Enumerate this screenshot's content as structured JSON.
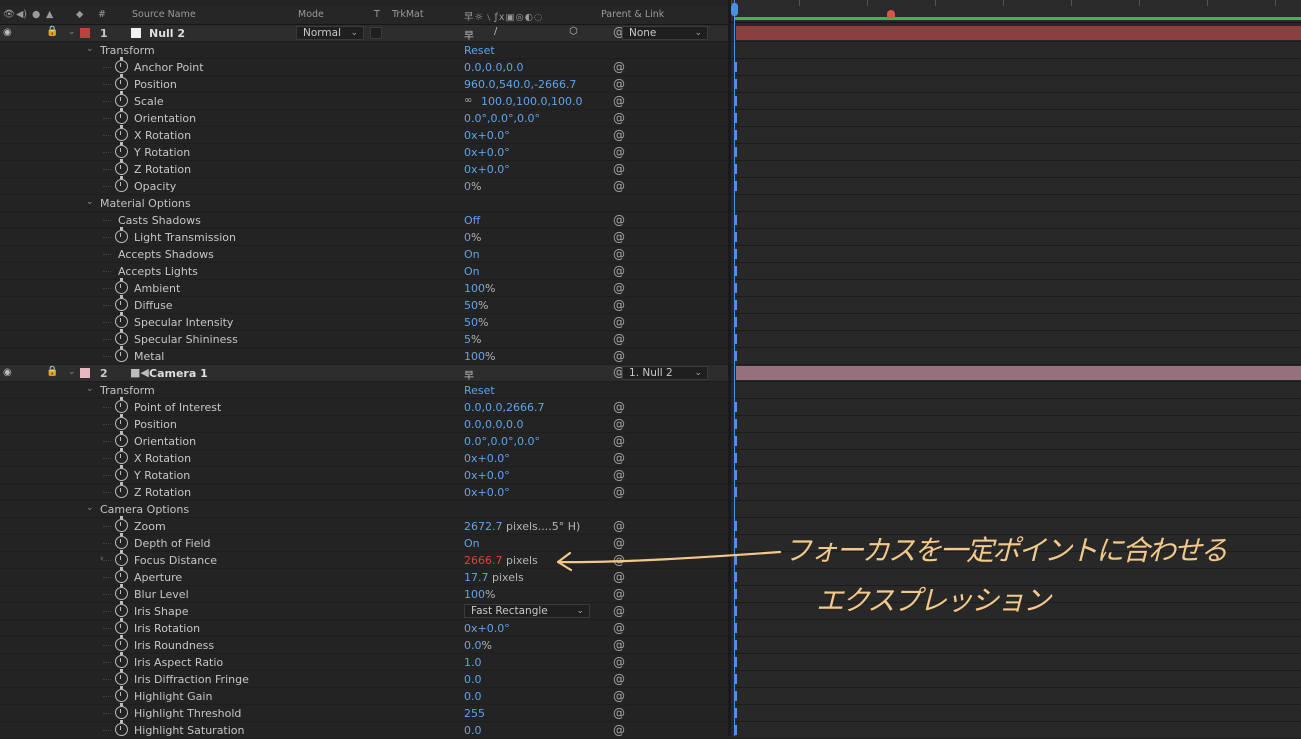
{
  "header": {
    "num": "#",
    "source_name": "Source Name",
    "mode": "Mode",
    "t": "T",
    "trkmat": "TrkMat",
    "parent_link": "Parent & Link"
  },
  "layers": [
    {
      "number": "1",
      "name": "Null 2",
      "label_color": "#c04040",
      "mode": "Normal",
      "parent": "None",
      "groups": [
        {
          "name": "Transform",
          "reset": "Reset",
          "props": [
            {
              "name": "Anchor Point",
              "stopwatch": true,
              "value": "0.0,0.0,0.0",
              "unit": ""
            },
            {
              "name": "Position",
              "stopwatch": true,
              "value": "960.0,540.0,-2666.7",
              "unit": ""
            },
            {
              "name": "Scale",
              "stopwatch": true,
              "value": "100.0,100.0,100.0",
              "unit": "",
              "link": true
            },
            {
              "name": "Orientation",
              "stopwatch": true,
              "value": "0.0°,0.0°,0.0°",
              "unit": ""
            },
            {
              "name": "X Rotation",
              "stopwatch": true,
              "value": "0x+0.0°",
              "unit": ""
            },
            {
              "name": "Y Rotation",
              "stopwatch": true,
              "value": "0x+0.0°",
              "unit": ""
            },
            {
              "name": "Z Rotation",
              "stopwatch": true,
              "value": "0x+0.0°",
              "unit": ""
            },
            {
              "name": "Opacity",
              "stopwatch": true,
              "value": "0",
              "unit": "%"
            }
          ]
        },
        {
          "name": "Material Options",
          "reset": "",
          "props": [
            {
              "name": "Casts Shadows",
              "stopwatch": false,
              "value": "Off",
              "unit": ""
            },
            {
              "name": "Light Transmission",
              "stopwatch": true,
              "value": "0",
              "unit": "%"
            },
            {
              "name": "Accepts Shadows",
              "stopwatch": false,
              "value": "On",
              "unit": ""
            },
            {
              "name": "Accepts Lights",
              "stopwatch": false,
              "value": "On",
              "unit": ""
            },
            {
              "name": "Ambient",
              "stopwatch": true,
              "value": "100",
              "unit": "%"
            },
            {
              "name": "Diffuse",
              "stopwatch": true,
              "value": "50",
              "unit": "%"
            },
            {
              "name": "Specular Intensity",
              "stopwatch": true,
              "value": "50",
              "unit": "%"
            },
            {
              "name": "Specular Shininess",
              "stopwatch": true,
              "value": "5",
              "unit": "%"
            },
            {
              "name": "Metal",
              "stopwatch": true,
              "value": "100",
              "unit": "%"
            }
          ]
        }
      ]
    },
    {
      "number": "2",
      "name": "Camera 1",
      "label_color": "#e6b8c4",
      "mode": "",
      "parent": "1. Null 2",
      "groups": [
        {
          "name": "Transform",
          "reset": "Reset",
          "props": [
            {
              "name": "Point of Interest",
              "stopwatch": true,
              "value": "0.0,0.0,2666.7",
              "unit": ""
            },
            {
              "name": "Position",
              "stopwatch": true,
              "value": "0.0,0.0,0.0",
              "unit": ""
            },
            {
              "name": "Orientation",
              "stopwatch": true,
              "value": "0.0°,0.0°,0.0°",
              "unit": ""
            },
            {
              "name": "X Rotation",
              "stopwatch": true,
              "value": "0x+0.0°",
              "unit": ""
            },
            {
              "name": "Y Rotation",
              "stopwatch": true,
              "value": "0x+0.0°",
              "unit": ""
            },
            {
              "name": "Z Rotation",
              "stopwatch": true,
              "value": "0x+0.0°",
              "unit": ""
            }
          ]
        },
        {
          "name": "Camera Options",
          "reset": "",
          "props": [
            {
              "name": "Zoom",
              "stopwatch": true,
              "value": "2672.7",
              "unit": " pixels....5° H)"
            },
            {
              "name": "Depth of Field",
              "stopwatch": true,
              "value": "On",
              "unit": ""
            },
            {
              "name": "Focus Distance",
              "stopwatch": true,
              "value": "2666.7",
              "unit": " pixels",
              "expression": true
            },
            {
              "name": "Aperture",
              "stopwatch": true,
              "value": "17.7",
              "unit": " pixels"
            },
            {
              "name": "Blur Level",
              "stopwatch": true,
              "value": "100",
              "unit": "%"
            },
            {
              "name": "Iris Shape",
              "stopwatch": true,
              "value": "Fast Rectangle",
              "unit": "",
              "dropdown": true
            },
            {
              "name": "Iris Rotation",
              "stopwatch": true,
              "value": "0x+0.0°",
              "unit": ""
            },
            {
              "name": "Iris Roundness",
              "stopwatch": true,
              "value": "0.0",
              "unit": "%"
            },
            {
              "name": "Iris Aspect Ratio",
              "stopwatch": true,
              "value": "1.0",
              "unit": ""
            },
            {
              "name": "Iris Diffraction Fringe",
              "stopwatch": true,
              "value": "0.0",
              "unit": ""
            },
            {
              "name": "Highlight Gain",
              "stopwatch": true,
              "value": "0.0",
              "unit": ""
            },
            {
              "name": "Highlight Threshold",
              "stopwatch": true,
              "value": "255",
              "unit": ""
            },
            {
              "name": "Highlight Saturation",
              "stopwatch": true,
              "value": "0.0",
              "unit": ""
            }
          ]
        }
      ]
    }
  ],
  "annotation": {
    "line1": "フォーカスを一定ポイントに合わせる",
    "line2": "エクスプレッション",
    "color": "#f2c98a"
  },
  "timeline": {
    "layer1_bar_color": "#8c3f3f",
    "layer2_bar_color": "#96707a",
    "work_area_color": "#3fb54a",
    "playhead_color": "#4a8fe6"
  }
}
